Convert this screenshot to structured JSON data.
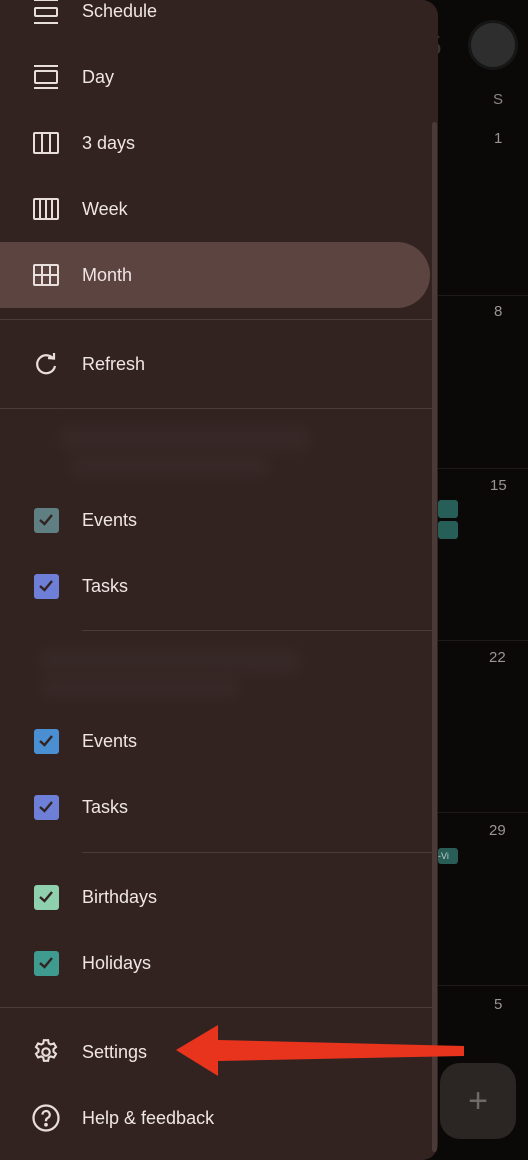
{
  "background": {
    "weekday_label": "S",
    "dates": [
      "1",
      "8",
      "15",
      "22",
      "29",
      "5"
    ],
    "chip_text": "-Vi",
    "fab_symbol": "+"
  },
  "drawer": {
    "views": [
      {
        "label": "Schedule",
        "icon": "schedule-view-icon"
      },
      {
        "label": "Day",
        "icon": "day-view-icon"
      },
      {
        "label": "3 days",
        "icon": "three-days-view-icon"
      },
      {
        "label": "Week",
        "icon": "week-view-icon"
      },
      {
        "label": "Month",
        "icon": "month-view-icon",
        "selected": true
      }
    ],
    "refresh_label": "Refresh",
    "account1": [
      {
        "label": "Events",
        "color": "#5f7f82"
      },
      {
        "label": "Tasks",
        "color": "#6d7fd6"
      }
    ],
    "account2": [
      {
        "label": "Events",
        "color": "#4a8fd1"
      },
      {
        "label": "Tasks",
        "color": "#6d7fd6"
      }
    ],
    "other": [
      {
        "label": "Birthdays",
        "color": "#8fd1ae"
      },
      {
        "label": "Holidays",
        "color": "#3f9a8f"
      }
    ],
    "settings_label": "Settings",
    "help_label": "Help & feedback"
  },
  "colors": {
    "drawer_bg": "#322321",
    "selected_bg": "#5c4441",
    "arrow": "#e8341c"
  }
}
